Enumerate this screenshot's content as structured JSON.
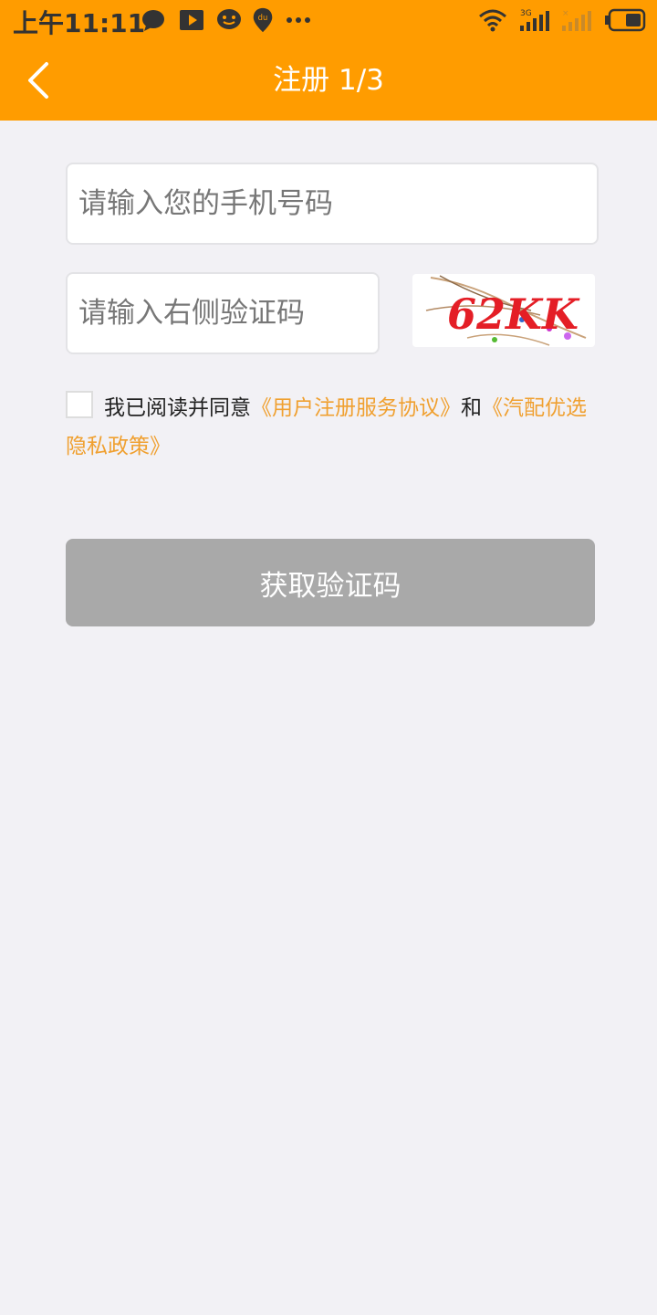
{
  "status_bar": {
    "time": "上午11:11",
    "network": "3G",
    "icons": [
      "chat-bubble-icon",
      "play-icon",
      "smile-chat-icon",
      "baidu-map-pin-icon",
      "more-dots-icon",
      "wifi-icon",
      "signal-3g-icon",
      "signal-no-sim-icon",
      "battery-icon"
    ]
  },
  "nav": {
    "title": "注册 1/3",
    "back_icon": "chevron-left-icon"
  },
  "form": {
    "phone_placeholder": "请输入您的手机号码",
    "phone_value": "",
    "captcha_placeholder": "请输入右侧验证码",
    "captcha_value": "",
    "captcha_image_text": "62KK"
  },
  "agreement": {
    "checked": false,
    "prefix": "我已阅读并同意",
    "link1": "《用户注册服务协议》",
    "middle": "和",
    "link2": "《汽配优选隐私政策》"
  },
  "submit": {
    "label": "获取验证码"
  },
  "colors": {
    "header": "#ff9c00",
    "background": "#f2f1f5",
    "link": "#f0a030",
    "button_disabled": "#a9a9a9"
  }
}
